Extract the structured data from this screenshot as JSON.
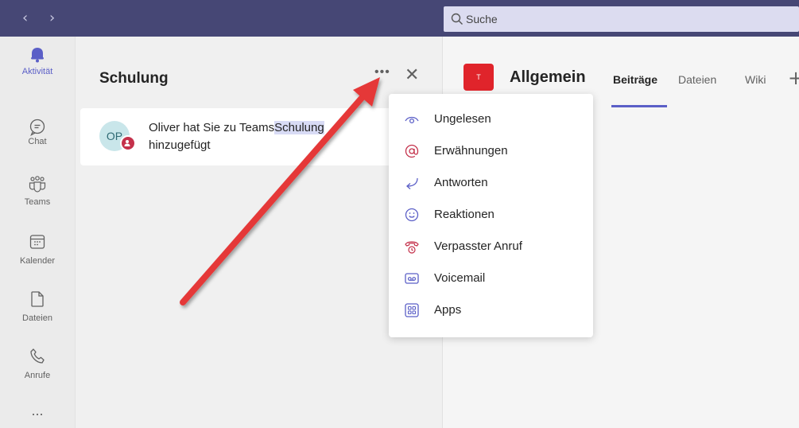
{
  "topbar": {
    "back_icon": "chevron-left-icon",
    "forward_icon": "chevron-right-icon",
    "search_placeholder": "Suche"
  },
  "rail": {
    "items": [
      {
        "label": "Aktivität",
        "icon": "bell-icon",
        "active": true
      },
      {
        "label": "Chat",
        "icon": "chat-icon"
      },
      {
        "label": "Teams",
        "icon": "teams-icon"
      },
      {
        "label": "Kalender",
        "icon": "calendar-icon"
      },
      {
        "label": "Dateien",
        "icon": "file-icon"
      },
      {
        "label": "Anrufe",
        "icon": "phone-icon"
      }
    ],
    "more": "..."
  },
  "activity_pane": {
    "title": "Schulung",
    "more_icon": "ellipsis-icon",
    "close_icon": "close-icon",
    "item": {
      "avatar_initials": "OP",
      "text_prefix": "Oliver hat Sie zu Teams",
      "text_highlight": "Schulung",
      "text_line2": "hinzugefügt"
    }
  },
  "channel_pane": {
    "team_initial": "T",
    "channel_name": "Allgemein",
    "tabs": [
      "Beiträge",
      "Dateien",
      "Wiki"
    ],
    "active_tab": "Beiträge",
    "add_tab": "+"
  },
  "filter_menu": {
    "items": [
      {
        "label": "Ungelesen",
        "icon": "eye-icon"
      },
      {
        "label": "Erwähnungen",
        "icon": "at-icon"
      },
      {
        "label": "Antworten",
        "icon": "reply-icon"
      },
      {
        "label": "Reaktionen",
        "icon": "smiley-icon"
      },
      {
        "label": "Verpasster Anruf",
        "icon": "missed-call-icon"
      },
      {
        "label": "Voicemail",
        "icon": "voicemail-icon"
      },
      {
        "label": "Apps",
        "icon": "apps-icon"
      }
    ]
  },
  "colors": {
    "brand": "#464775",
    "accent": "#5b5fc7",
    "menu_icon": "#5b5fc7",
    "alert_red": "#c4314b",
    "arrow": "#e53939"
  }
}
